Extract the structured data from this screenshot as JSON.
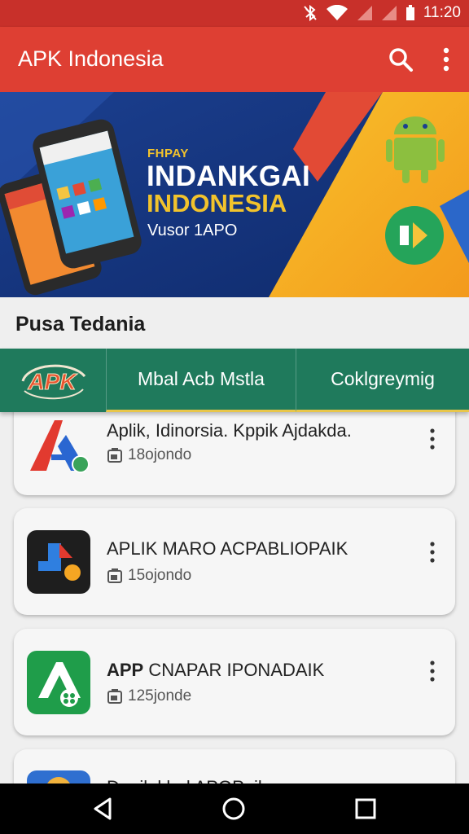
{
  "status_bar": {
    "time": "11:20"
  },
  "app_bar": {
    "title": "APK Indonesia",
    "search_icon": "search-icon",
    "more_icon": "more-vert-icon"
  },
  "banner": {
    "small_text": "FHPAY",
    "title_line1": "INDANKGAI",
    "title_line2": "INDONESIA",
    "subtitle": "Vusor 1APO"
  },
  "section": {
    "title": "Pusa Tedania"
  },
  "tabs": {
    "logo_text": "APK",
    "items": [
      {
        "label": "Mbal Acb Mstla"
      },
      {
        "label": "Coklgreymig"
      }
    ]
  },
  "apps": [
    {
      "name": "Aplik, Idinorsia. Kppik Ajdakda.",
      "size": "18ojondo"
    },
    {
      "name": "APLIK MARO ACPABLIOPAIK",
      "size": "15ojondo"
    },
    {
      "name_bold": "APP",
      "name": " CNAPAR IPONADAIK",
      "size": "125jonde"
    },
    {
      "name": "Dapilaklarl APOPaik"
    }
  ],
  "colors": {
    "app_bar": "#de3f33",
    "status_bar": "#c8302a",
    "tab_bar": "#1f7a5c",
    "tab_accent": "#e8c64a"
  }
}
